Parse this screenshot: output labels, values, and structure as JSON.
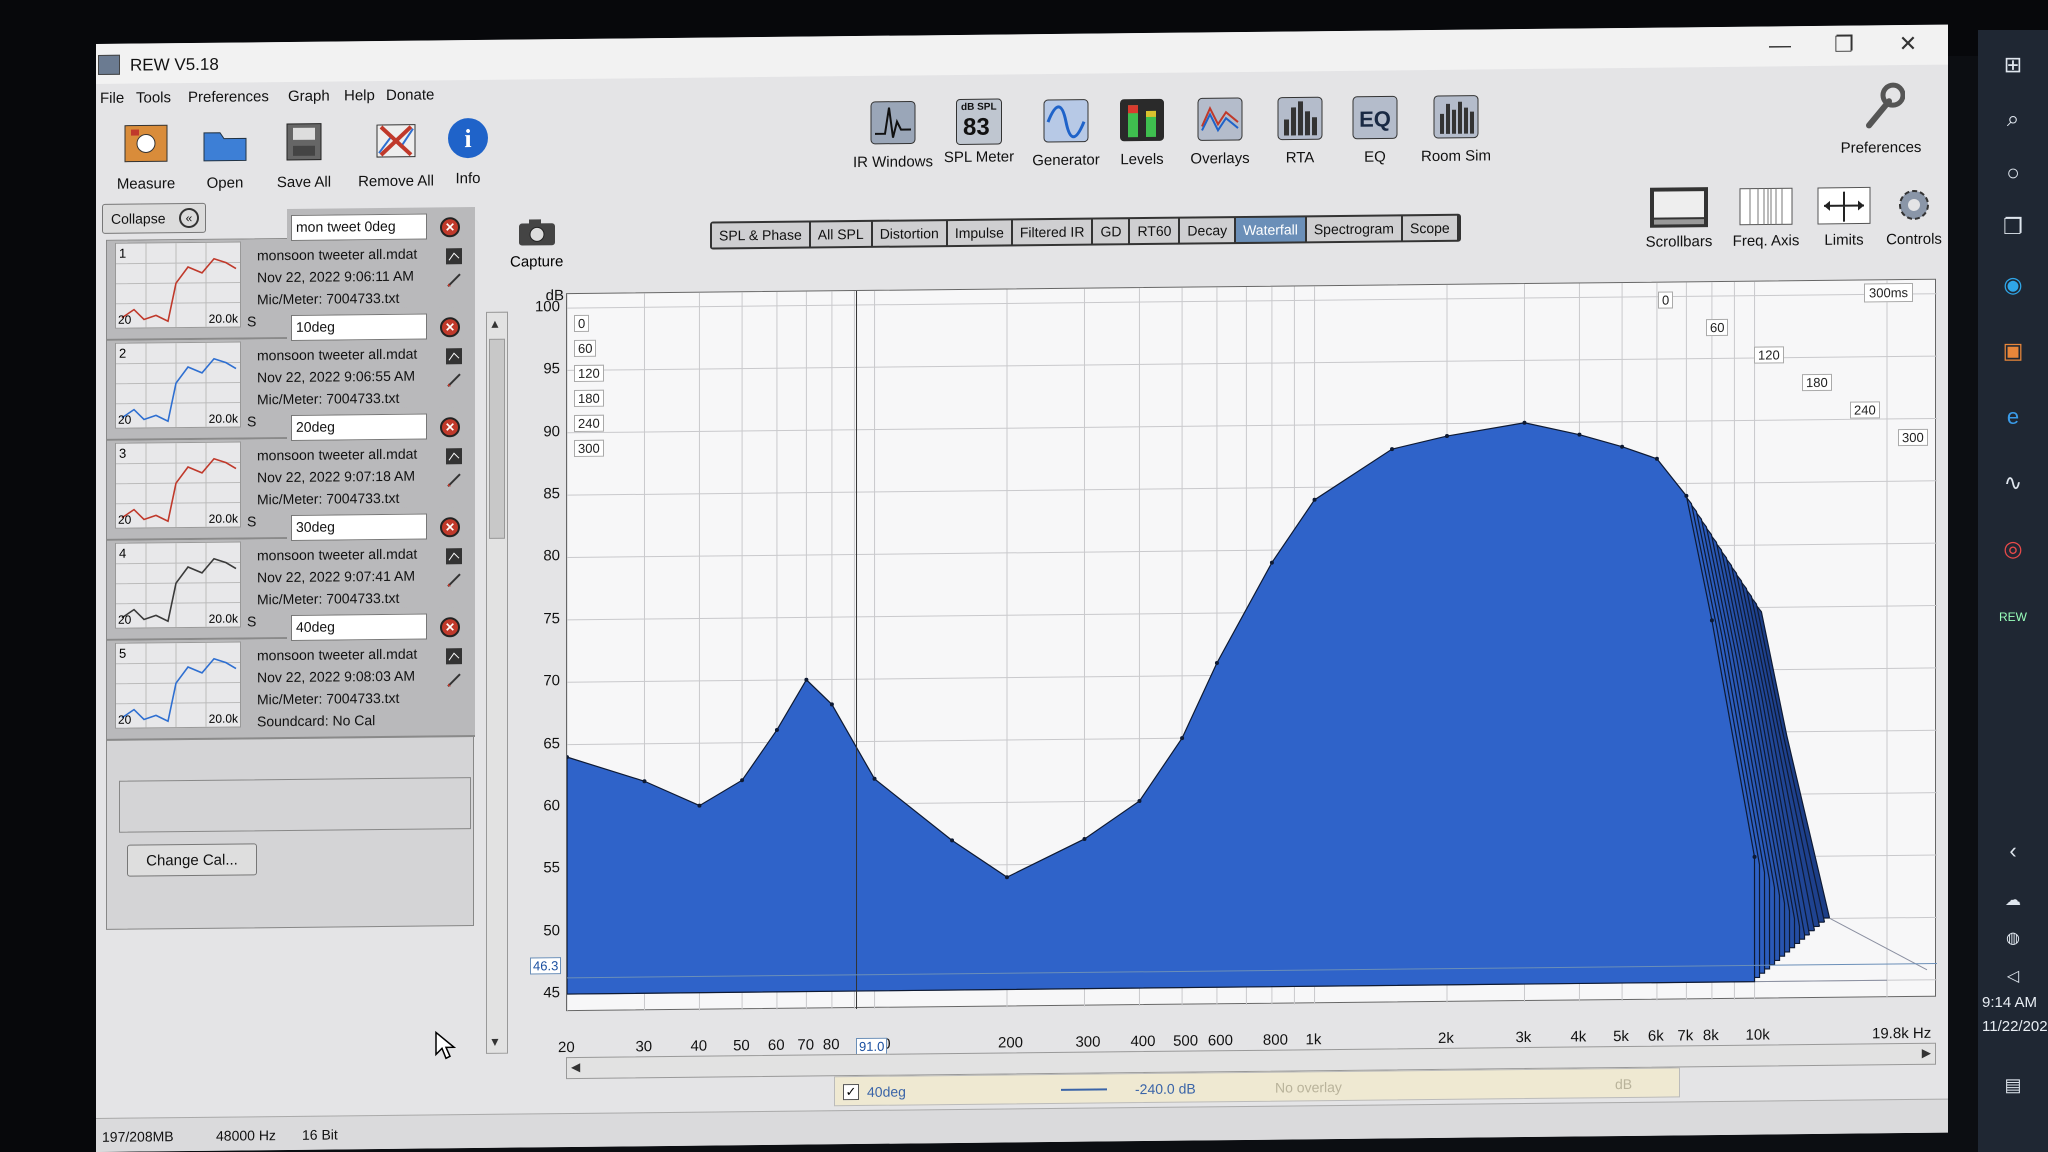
{
  "window": {
    "title": "REW V5.18",
    "controls": {
      "minimize": "—",
      "restore": "❐",
      "close": "✕"
    }
  },
  "menu": [
    "File",
    "Tools",
    "Preferences",
    "Graph",
    "Help",
    "Donate"
  ],
  "toolbar_left": [
    {
      "label": "Measure",
      "icon": "measure-icon"
    },
    {
      "label": "Open",
      "icon": "folder-icon"
    },
    {
      "label": "Save All",
      "icon": "save-all-icon"
    },
    {
      "label": "Remove All",
      "icon": "remove-all-icon"
    },
    {
      "label": "Info",
      "icon": "info-icon"
    }
  ],
  "toolbar_center": [
    {
      "label": "IR Windows",
      "icon": "ir-windows-icon"
    },
    {
      "label": "SPL Meter",
      "icon": "spl-meter-icon",
      "badge_top": "dB SPL",
      "badge_value": "83"
    },
    {
      "label": "Generator",
      "icon": "generator-icon"
    },
    {
      "label": "Levels",
      "icon": "levels-icon"
    },
    {
      "label": "Overlays",
      "icon": "overlays-icon"
    },
    {
      "label": "RTA",
      "icon": "rta-icon"
    },
    {
      "label": "EQ",
      "icon": "eq-icon"
    },
    {
      "label": "Room Sim",
      "icon": "room-sim-icon"
    }
  ],
  "preferences_label": "Preferences",
  "collapse_label": "Collapse",
  "collapse_glyph": "«",
  "measurements": [
    {
      "num": "1",
      "name": "mon tweet 0deg",
      "file": "monsoon tweeter all.mdat",
      "date": "Nov 22, 2022 9:06:11 AM",
      "mic": "Mic/Meter: 7004733.txt",
      "lo": "20",
      "hi": "20.0k",
      "trace": "#c0392b",
      "stub": "S"
    },
    {
      "num": "2",
      "name": "10deg",
      "file": "monsoon tweeter all.mdat",
      "date": "Nov 22, 2022 9:06:55 AM",
      "mic": "Mic/Meter: 7004733.txt",
      "lo": "20",
      "hi": "20.0k",
      "trace": "#2e6fd1",
      "stub": "S"
    },
    {
      "num": "3",
      "name": "20deg",
      "file": "monsoon tweeter all.mdat",
      "date": "Nov 22, 2022 9:07:18 AM",
      "mic": "Mic/Meter: 7004733.txt",
      "lo": "20",
      "hi": "20.0k",
      "trace": "#c0392b",
      "stub": "S"
    },
    {
      "num": "4",
      "name": "30deg",
      "file": "monsoon tweeter all.mdat",
      "date": "Nov 22, 2022 9:07:41 AM",
      "mic": "Mic/Meter: 7004733.txt",
      "lo": "20",
      "hi": "20.0k",
      "trace": "#3a3a3a",
      "stub": "S"
    },
    {
      "num": "5",
      "name": "40deg",
      "file": "monsoon tweeter all.mdat",
      "date": "Nov 22, 2022 9:08:03 AM",
      "mic": "Mic/Meter: 7004733.txt",
      "soundcard": "Soundcard: No Cal",
      "lo": "20",
      "hi": "20.0k",
      "trace": "#2e6fd1"
    }
  ],
  "change_cal_label": "Change Cal...",
  "capture_label": "Capture",
  "graph_tabs": [
    "SPL & Phase",
    "All SPL",
    "Distortion",
    "Impulse",
    "Filtered IR",
    "GD",
    "RT60",
    "Decay",
    "Waterfall",
    "Spectrogram",
    "Scope"
  ],
  "active_tab": "Waterfall",
  "right_tools": [
    {
      "label": "Scrollbars",
      "icon": "scrollbars-icon"
    },
    {
      "label": "Freq. Axis",
      "icon": "freq-axis-icon"
    },
    {
      "label": "Limits",
      "icon": "limits-icon"
    },
    {
      "label": "Controls",
      "icon": "gear-icon"
    }
  ],
  "chart_data": {
    "type": "area",
    "subtype": "waterfall",
    "ylabel": "dB",
    "y_ticks": [
      "100",
      "95",
      "90",
      "85",
      "80",
      "75",
      "70",
      "65",
      "60",
      "55",
      "50",
      "45"
    ],
    "x_ticks": [
      "20",
      "30",
      "40",
      "50",
      "60",
      "70",
      "80",
      "100",
      "200",
      "300",
      "400",
      "500",
      "600",
      "800",
      "1k",
      "2k",
      "3k",
      "4k",
      "5k",
      "6k",
      "7k",
      "8k",
      "10k"
    ],
    "x_end_label": "19.8k Hz",
    "x_scale": "log",
    "ylim": [
      45,
      100
    ],
    "time_slices_front": [
      "0",
      "60",
      "120",
      "180",
      "240",
      "300"
    ],
    "time_slices_back": [
      "0",
      "60",
      "120",
      "180",
      "240",
      "300"
    ],
    "time_span_label": "300ms",
    "cursor_y_value": "46.3",
    "cursor_x_value": "91.0",
    "grid": true,
    "color": "#2f63c9",
    "series": [
      {
        "name": "40deg",
        "x": [
          20,
          30,
          40,
          50,
          60,
          70,
          80,
          100,
          150,
          200,
          300,
          400,
          500,
          600,
          800,
          1000,
          1500,
          2000,
          3000,
          4000,
          5000,
          6000,
          7000,
          8000,
          10000
        ],
        "y": [
          64,
          62,
          60,
          62,
          66,
          70,
          68,
          62,
          57,
          54,
          57,
          60,
          65,
          71,
          79,
          84,
          88,
          89,
          90,
          89,
          88,
          87,
          84,
          74,
          55
        ]
      }
    ]
  },
  "legend": {
    "checked": "✓",
    "name": "40deg",
    "value": "-240.0 dB",
    "no_overlay": "No overlay",
    "unit": "dB"
  },
  "status": {
    "memory": "197/208MB",
    "rate": "48000 Hz",
    "bits": "16 Bit"
  },
  "taskbar": {
    "time": "9:14 AM",
    "date": "11/22/2022"
  }
}
